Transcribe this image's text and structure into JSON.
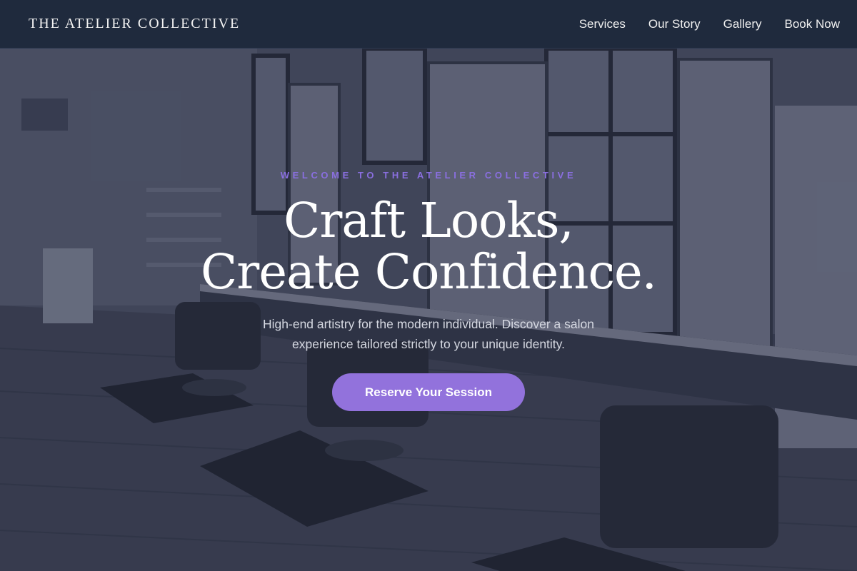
{
  "nav": {
    "brand": "THE ATELIER COLLECTIVE",
    "links": [
      "Services",
      "Our Story",
      "Gallery",
      "Book Now"
    ]
  },
  "hero": {
    "eyebrow": "WELCOME TO THE ATELIER COLLECTIVE",
    "headline_line1": "Craft Looks,",
    "headline_line2": "Create Confidence.",
    "subtext": "High-end artistry for the modern individual. Discover a salon experience tailored strictly to your unique identity.",
    "cta_label": "Reserve Your Session",
    "background": "salon-interior-photo"
  },
  "colors": {
    "nav_bg": "#1f2a3d",
    "accent": "#9272dc",
    "eyebrow": "#8a6fe0",
    "overlay": "#1c2238"
  }
}
